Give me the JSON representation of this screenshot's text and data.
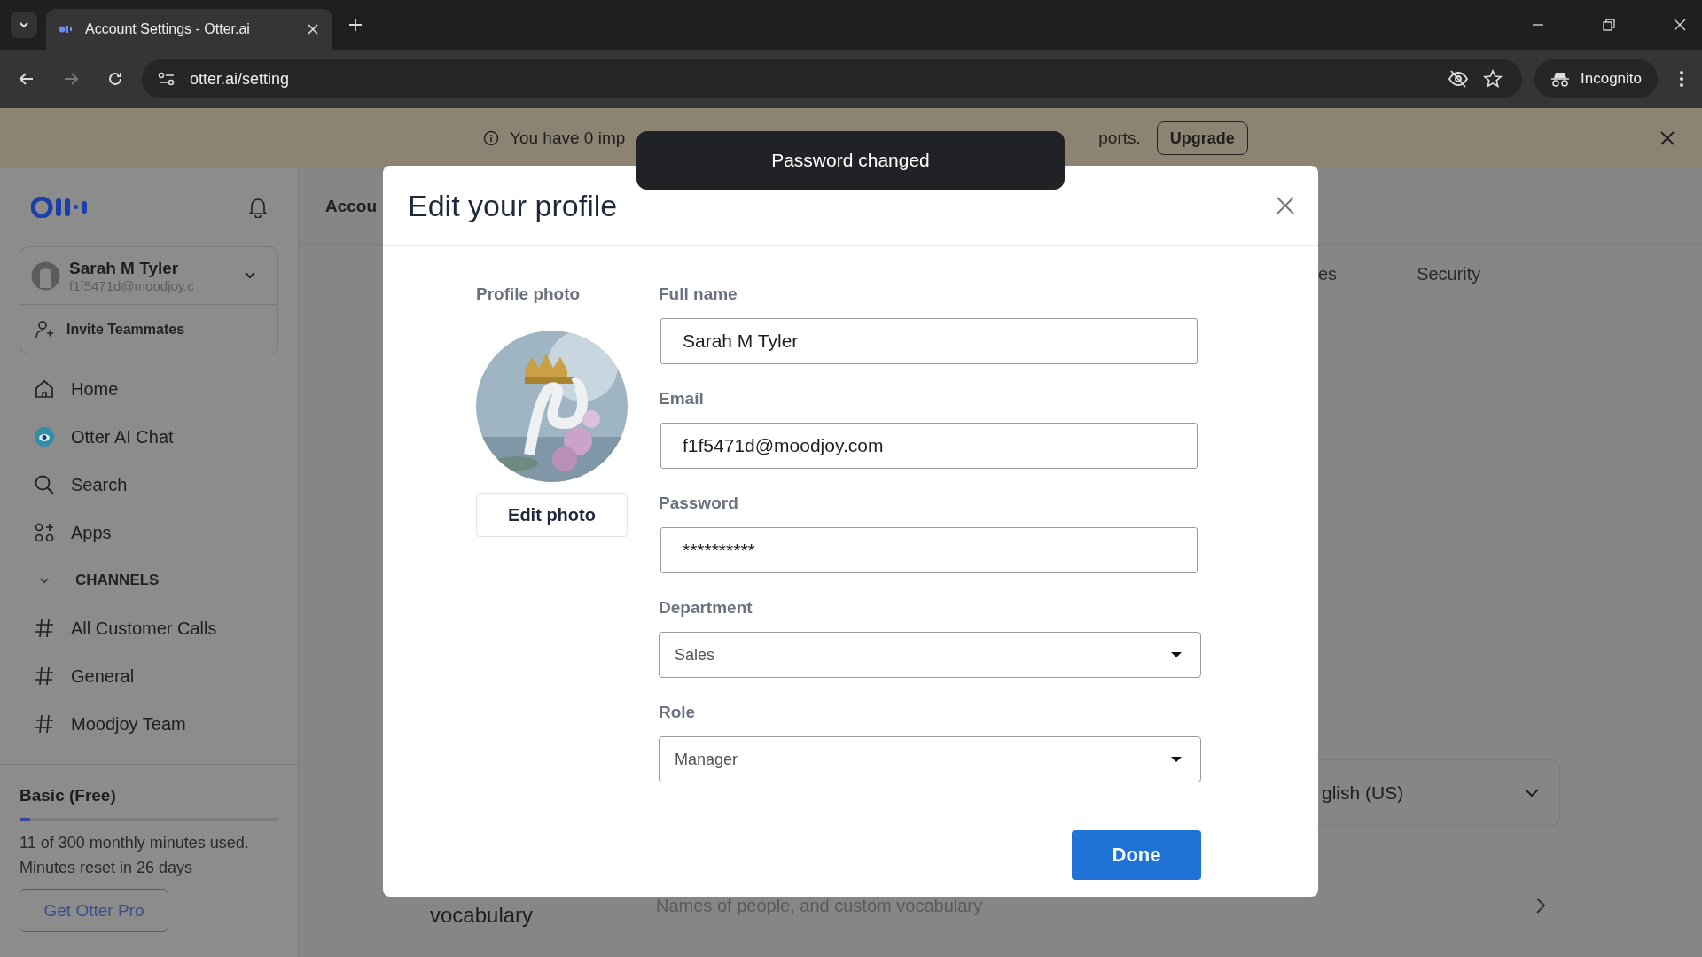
{
  "browser": {
    "tab_title": "Account Settings - Otter.ai",
    "url": "otter.ai/setting",
    "profile_label": "Incognito",
    "nav_buttons": [
      {
        "kind": "back",
        "disabled": false
      },
      {
        "kind": "forward",
        "disabled": true
      },
      {
        "kind": "reload",
        "disabled": false
      }
    ]
  },
  "banner": {
    "text_start": "You have 0 imp",
    "text_end": "ports.",
    "button": "Upgrade"
  },
  "toast": {
    "text": "Password changed"
  },
  "sidebar": {
    "user": {
      "name": "Sarah M Tyler",
      "email": "f1f5471d@moodjoy.c"
    },
    "invite": "Invite Teammates",
    "nav": [
      {
        "kind": "home",
        "label": "Home"
      },
      {
        "kind": "chat",
        "label": "Otter AI Chat"
      },
      {
        "kind": "search",
        "label": "Search"
      },
      {
        "kind": "apps",
        "label": "Apps"
      }
    ],
    "channels_heading": "CHANNELS",
    "channels": [
      "All Customer Calls",
      "General",
      "Moodjoy Team"
    ],
    "plan": {
      "name": "Basic (Free)",
      "level": 0.04,
      "usage": "11 of 300 monthly minutes used.",
      "reset": "Minutes reset in 26 days",
      "button": "Get Otter Pro"
    }
  },
  "main": {
    "heading": "Accou",
    "tabs": [
      "es",
      "Security"
    ],
    "language_value": "glish (US)",
    "vocabulary": {
      "label": "vocabulary",
      "description": "Names of people, and custom vocabulary"
    }
  },
  "modal": {
    "title": "Edit your profile",
    "photo_label": "Profile photo",
    "photo_button": "Edit photo",
    "fields": [
      {
        "kind": "text",
        "label": "Full name",
        "value": "Sarah M Tyler"
      },
      {
        "kind": "text",
        "label": "Email",
        "value": "f1f5471d@moodjoy.com"
      },
      {
        "kind": "text",
        "label": "Password",
        "value": "**********"
      },
      {
        "kind": "select",
        "label": "Department",
        "value": "Sales"
      },
      {
        "kind": "select",
        "label": "Role",
        "value": "Manager"
      }
    ],
    "button": "Done"
  }
}
